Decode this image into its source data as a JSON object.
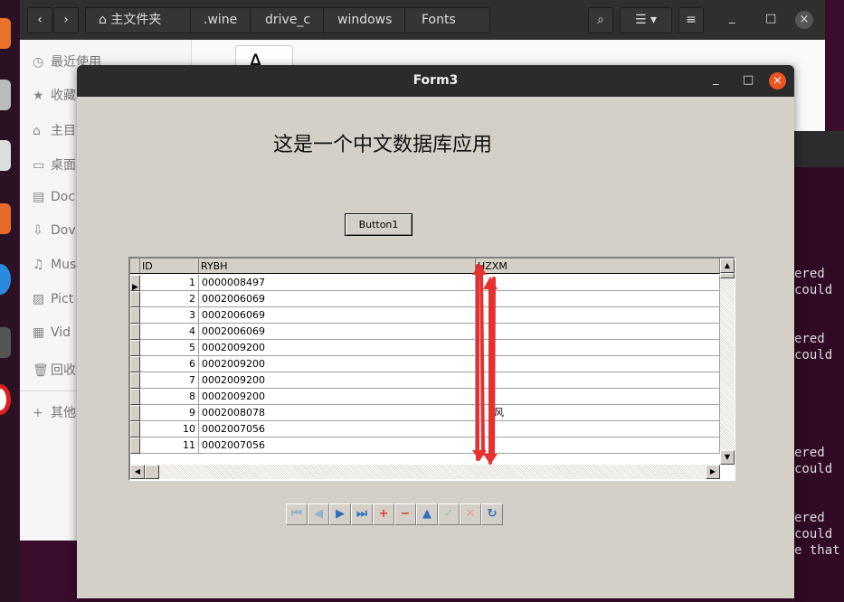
{
  "file_manager": {
    "breadcrumbs": [
      "主文件夹",
      ".wine",
      "drive_c",
      "windows",
      "Fonts"
    ],
    "sidebar": [
      {
        "icon": "clock-icon",
        "label": "最近使用"
      },
      {
        "icon": "star-icon",
        "label": "收藏"
      },
      {
        "icon": "home-icon",
        "label": "主目"
      },
      {
        "icon": "desktop-icon",
        "label": "桌面"
      },
      {
        "icon": "document-icon",
        "label": "Doc"
      },
      {
        "icon": "download-icon",
        "label": "Dov"
      },
      {
        "icon": "music-icon",
        "label": "Mus"
      },
      {
        "icon": "picture-icon",
        "label": "Pict"
      },
      {
        "icon": "video-icon",
        "label": "Vid"
      },
      {
        "icon": "trash-icon",
        "label": "回收"
      },
      {
        "icon": "plus-icon",
        "label": "其他"
      }
    ],
    "file_glyph": "A"
  },
  "terminal": {
    "lines": [
      "ered",
      "could ",
      "ered",
      "could ",
      "ered",
      "could ",
      "ered",
      "could ",
      "e that"
    ]
  },
  "form": {
    "title": "Form3",
    "heading": "这是一个中文数据库应用",
    "button1": "Button1",
    "grid": {
      "columns": [
        "ID",
        "RYBH",
        "HZXM"
      ],
      "rows": [
        [
          "1",
          "0000008497",
          ""
        ],
        [
          "2",
          "0002006069",
          ""
        ],
        [
          "3",
          "0002006069",
          ""
        ],
        [
          "4",
          "0002006069",
          ""
        ],
        [
          "5",
          "0002009200",
          ""
        ],
        [
          "6",
          "0002009200",
          ""
        ],
        [
          "7",
          "0002009200",
          ""
        ],
        [
          "8",
          "0002009200",
          ""
        ],
        [
          "9",
          "0002008078",
          "风"
        ],
        [
          "10",
          "0002007056",
          ""
        ],
        [
          "11",
          "0002007056",
          ""
        ]
      ]
    },
    "navigator": [
      {
        "name": "first",
        "glyph": "⏮",
        "color": "#8fb3d0"
      },
      {
        "name": "prior",
        "glyph": "◀",
        "color": "#8fb3d0"
      },
      {
        "name": "next",
        "glyph": "▶",
        "color": "#2e6fbf"
      },
      {
        "name": "last",
        "glyph": "⏭",
        "color": "#2e6fbf"
      },
      {
        "name": "insert",
        "glyph": "+",
        "color": "#e04030"
      },
      {
        "name": "delete",
        "glyph": "−",
        "color": "#e04030"
      },
      {
        "name": "edit",
        "glyph": "▲",
        "color": "#2e6fbf"
      },
      {
        "name": "post",
        "glyph": "✓",
        "color": "#9cc6a0"
      },
      {
        "name": "cancel",
        "glyph": "✕",
        "color": "#e8a090"
      },
      {
        "name": "refresh",
        "glyph": "↻",
        "color": "#2e6fbf"
      }
    ],
    "annotation_color": "#e83030"
  }
}
